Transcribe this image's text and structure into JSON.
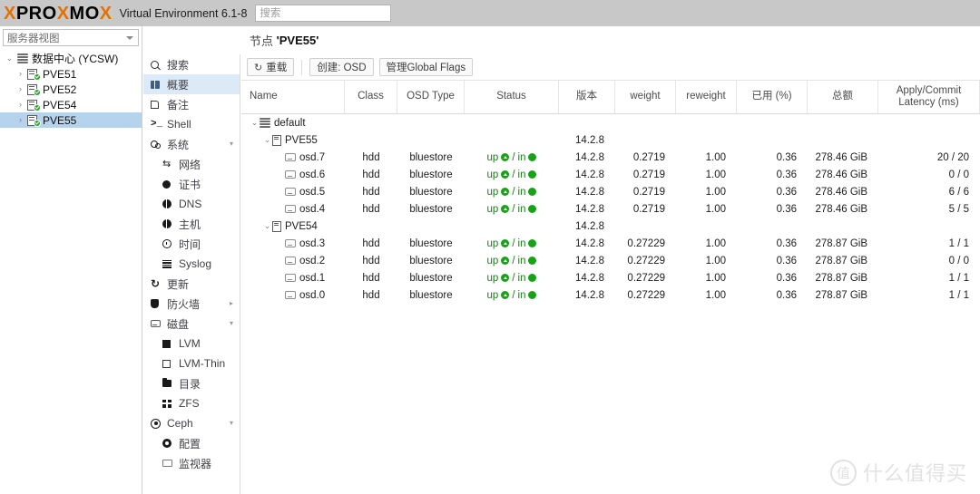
{
  "topbar": {
    "logo_parts": [
      "X",
      "PRO",
      "X",
      "MO",
      "X"
    ],
    "product": "Virtual Environment 6.1-8",
    "search_placeholder": "搜索",
    "search_value": ""
  },
  "tree_panel": {
    "view_select": {
      "label": "服务器视图"
    },
    "nodes": [
      {
        "label": "数据中心 (YCSW)",
        "type": "datacenter",
        "level": 0,
        "twisty": "⌄",
        "selected": false
      },
      {
        "label": "PVE51",
        "type": "node",
        "level": 1,
        "twisty": "›",
        "selected": false
      },
      {
        "label": "PVE52",
        "type": "node",
        "level": 1,
        "twisty": "›",
        "selected": false
      },
      {
        "label": "PVE54",
        "type": "node",
        "level": 1,
        "twisty": "›",
        "selected": false
      },
      {
        "label": "PVE55",
        "type": "node",
        "level": 1,
        "twisty": "›",
        "selected": true
      }
    ]
  },
  "nav": {
    "items": [
      {
        "label": "搜索",
        "icon": "search-icon",
        "child": false,
        "active": false,
        "arrow": ""
      },
      {
        "label": "概要",
        "icon": "summary-icon",
        "child": false,
        "active": true,
        "arrow": ""
      },
      {
        "label": "备注",
        "icon": "notes-icon",
        "child": false,
        "active": false,
        "arrow": ""
      },
      {
        "label": "Shell",
        "icon": "shell-icon",
        "child": false,
        "active": false,
        "arrow": ""
      },
      {
        "label": "系统",
        "icon": "system-icon",
        "child": false,
        "active": false,
        "arrow": "▾"
      },
      {
        "label": "网络",
        "icon": "network-icon",
        "child": true,
        "active": false,
        "arrow": ""
      },
      {
        "label": "证书",
        "icon": "certificate-icon",
        "child": true,
        "active": false,
        "arrow": ""
      },
      {
        "label": "DNS",
        "icon": "dns-icon",
        "child": true,
        "active": false,
        "arrow": ""
      },
      {
        "label": "主机",
        "icon": "hosts-icon",
        "child": true,
        "active": false,
        "arrow": ""
      },
      {
        "label": "时间",
        "icon": "time-icon",
        "child": true,
        "active": false,
        "arrow": ""
      },
      {
        "label": "Syslog",
        "icon": "syslog-icon",
        "child": true,
        "active": false,
        "arrow": ""
      },
      {
        "label": "更新",
        "icon": "updates-icon",
        "child": false,
        "active": false,
        "arrow": ""
      },
      {
        "label": "防火墙",
        "icon": "firewall-icon",
        "child": false,
        "active": false,
        "arrow": "▸"
      },
      {
        "label": "磁盘",
        "icon": "disks-icon",
        "child": false,
        "active": false,
        "arrow": "▾"
      },
      {
        "label": "LVM",
        "icon": "lvm-icon",
        "child": true,
        "active": false,
        "arrow": ""
      },
      {
        "label": "LVM-Thin",
        "icon": "lvm-thin-icon",
        "child": true,
        "active": false,
        "arrow": ""
      },
      {
        "label": "目录",
        "icon": "directory-icon",
        "child": true,
        "active": false,
        "arrow": ""
      },
      {
        "label": "ZFS",
        "icon": "zfs-icon",
        "child": true,
        "active": false,
        "arrow": ""
      },
      {
        "label": "Ceph",
        "icon": "ceph-icon",
        "child": false,
        "active": false,
        "arrow": "▾"
      },
      {
        "label": "配置",
        "icon": "config-icon",
        "child": true,
        "active": false,
        "arrow": ""
      },
      {
        "label": "监视器",
        "icon": "monitor-icon",
        "child": true,
        "active": false,
        "arrow": ""
      }
    ]
  },
  "content": {
    "header_prefix": "节点",
    "header_node": "'PVE55'",
    "toolbar": {
      "reload_label": "重载",
      "create_osd_label": "创建: OSD",
      "global_flags_label": "管理Global Flags"
    },
    "columns": [
      {
        "key": "name",
        "label": "Name"
      },
      {
        "key": "class",
        "label": "Class"
      },
      {
        "key": "osd_type",
        "label": "OSD Type"
      },
      {
        "key": "status",
        "label": "Status"
      },
      {
        "key": "version",
        "label": "版本"
      },
      {
        "key": "weight",
        "label": "weight"
      },
      {
        "key": "reweight",
        "label": "reweight"
      },
      {
        "key": "used",
        "label": "已用 (%)"
      },
      {
        "key": "total",
        "label": "总额"
      },
      {
        "key": "latency",
        "label": "Apply/Commit Latency (ms)"
      }
    ],
    "rows": [
      {
        "kind": "root",
        "indent": 0,
        "twisty": "⌄",
        "icon": "rack-icon",
        "name": "default",
        "class": "",
        "osd_type": "",
        "status": "",
        "version": "",
        "weight": "",
        "reweight": "",
        "used": "",
        "total": "",
        "latency": ""
      },
      {
        "kind": "host",
        "indent": 1,
        "twisty": "⌄",
        "icon": "server-icon",
        "name": "PVE55",
        "class": "",
        "osd_type": "",
        "status": "",
        "version": "14.2.8",
        "weight": "",
        "reweight": "",
        "used": "",
        "total": "",
        "latency": ""
      },
      {
        "kind": "osd",
        "indent": 2,
        "twisty": "",
        "icon": "disk-icon",
        "name": "osd.7",
        "class": "hdd",
        "osd_type": "bluestore",
        "status_up": "up",
        "status_in": "in",
        "version": "14.2.8",
        "weight": "0.2719",
        "reweight": "1.00",
        "used": "0.36",
        "total": "278.46 GiB",
        "latency": "20 / 20"
      },
      {
        "kind": "osd",
        "indent": 2,
        "twisty": "",
        "icon": "disk-icon",
        "name": "osd.6",
        "class": "hdd",
        "osd_type": "bluestore",
        "status_up": "up",
        "status_in": "in",
        "version": "14.2.8",
        "weight": "0.2719",
        "reweight": "1.00",
        "used": "0.36",
        "total": "278.46 GiB",
        "latency": "0 / 0"
      },
      {
        "kind": "osd",
        "indent": 2,
        "twisty": "",
        "icon": "disk-icon",
        "name": "osd.5",
        "class": "hdd",
        "osd_type": "bluestore",
        "status_up": "up",
        "status_in": "in",
        "version": "14.2.8",
        "weight": "0.2719",
        "reweight": "1.00",
        "used": "0.36",
        "total": "278.46 GiB",
        "latency": "6 / 6"
      },
      {
        "kind": "osd",
        "indent": 2,
        "twisty": "",
        "icon": "disk-icon",
        "name": "osd.4",
        "class": "hdd",
        "osd_type": "bluestore",
        "status_up": "up",
        "status_in": "in",
        "version": "14.2.8",
        "weight": "0.2719",
        "reweight": "1.00",
        "used": "0.36",
        "total": "278.46 GiB",
        "latency": "5 / 5"
      },
      {
        "kind": "host",
        "indent": 1,
        "twisty": "⌄",
        "icon": "server-icon",
        "name": "PVE54",
        "class": "",
        "osd_type": "",
        "status": "",
        "version": "14.2.8",
        "weight": "",
        "reweight": "",
        "used": "",
        "total": "",
        "latency": ""
      },
      {
        "kind": "osd",
        "indent": 2,
        "twisty": "",
        "icon": "disk-icon",
        "name": "osd.3",
        "class": "hdd",
        "osd_type": "bluestore",
        "status_up": "up",
        "status_in": "in",
        "version": "14.2.8",
        "weight": "0.27229",
        "reweight": "1.00",
        "used": "0.36",
        "total": "278.87 GiB",
        "latency": "1 / 1"
      },
      {
        "kind": "osd",
        "indent": 2,
        "twisty": "",
        "icon": "disk-icon",
        "name": "osd.2",
        "class": "hdd",
        "osd_type": "bluestore",
        "status_up": "up",
        "status_in": "in",
        "version": "14.2.8",
        "weight": "0.27229",
        "reweight": "1.00",
        "used": "0.36",
        "total": "278.87 GiB",
        "latency": "0 / 0"
      },
      {
        "kind": "osd",
        "indent": 2,
        "twisty": "",
        "icon": "disk-icon",
        "name": "osd.1",
        "class": "hdd",
        "osd_type": "bluestore",
        "status_up": "up",
        "status_in": "in",
        "version": "14.2.8",
        "weight": "0.27229",
        "reweight": "1.00",
        "used": "0.36",
        "total": "278.87 GiB",
        "latency": "1 / 1"
      },
      {
        "kind": "osd",
        "indent": 2,
        "twisty": "",
        "icon": "disk-icon",
        "name": "osd.0",
        "class": "hdd",
        "osd_type": "bluestore",
        "status_up": "up",
        "status_in": "in",
        "version": "14.2.8",
        "weight": "0.27229",
        "reweight": "1.00",
        "used": "0.36",
        "total": "278.87 GiB",
        "latency": "1 / 1"
      }
    ]
  },
  "watermark": {
    "mark": "值",
    "text": "什么值得买"
  },
  "colors": {
    "accent_orange": "#e57000",
    "topbar_grey": "#c8c8c8",
    "selection_blue": "#b5d3ec",
    "nav_active_blue": "#dce9f6",
    "status_green": "#17a217"
  }
}
